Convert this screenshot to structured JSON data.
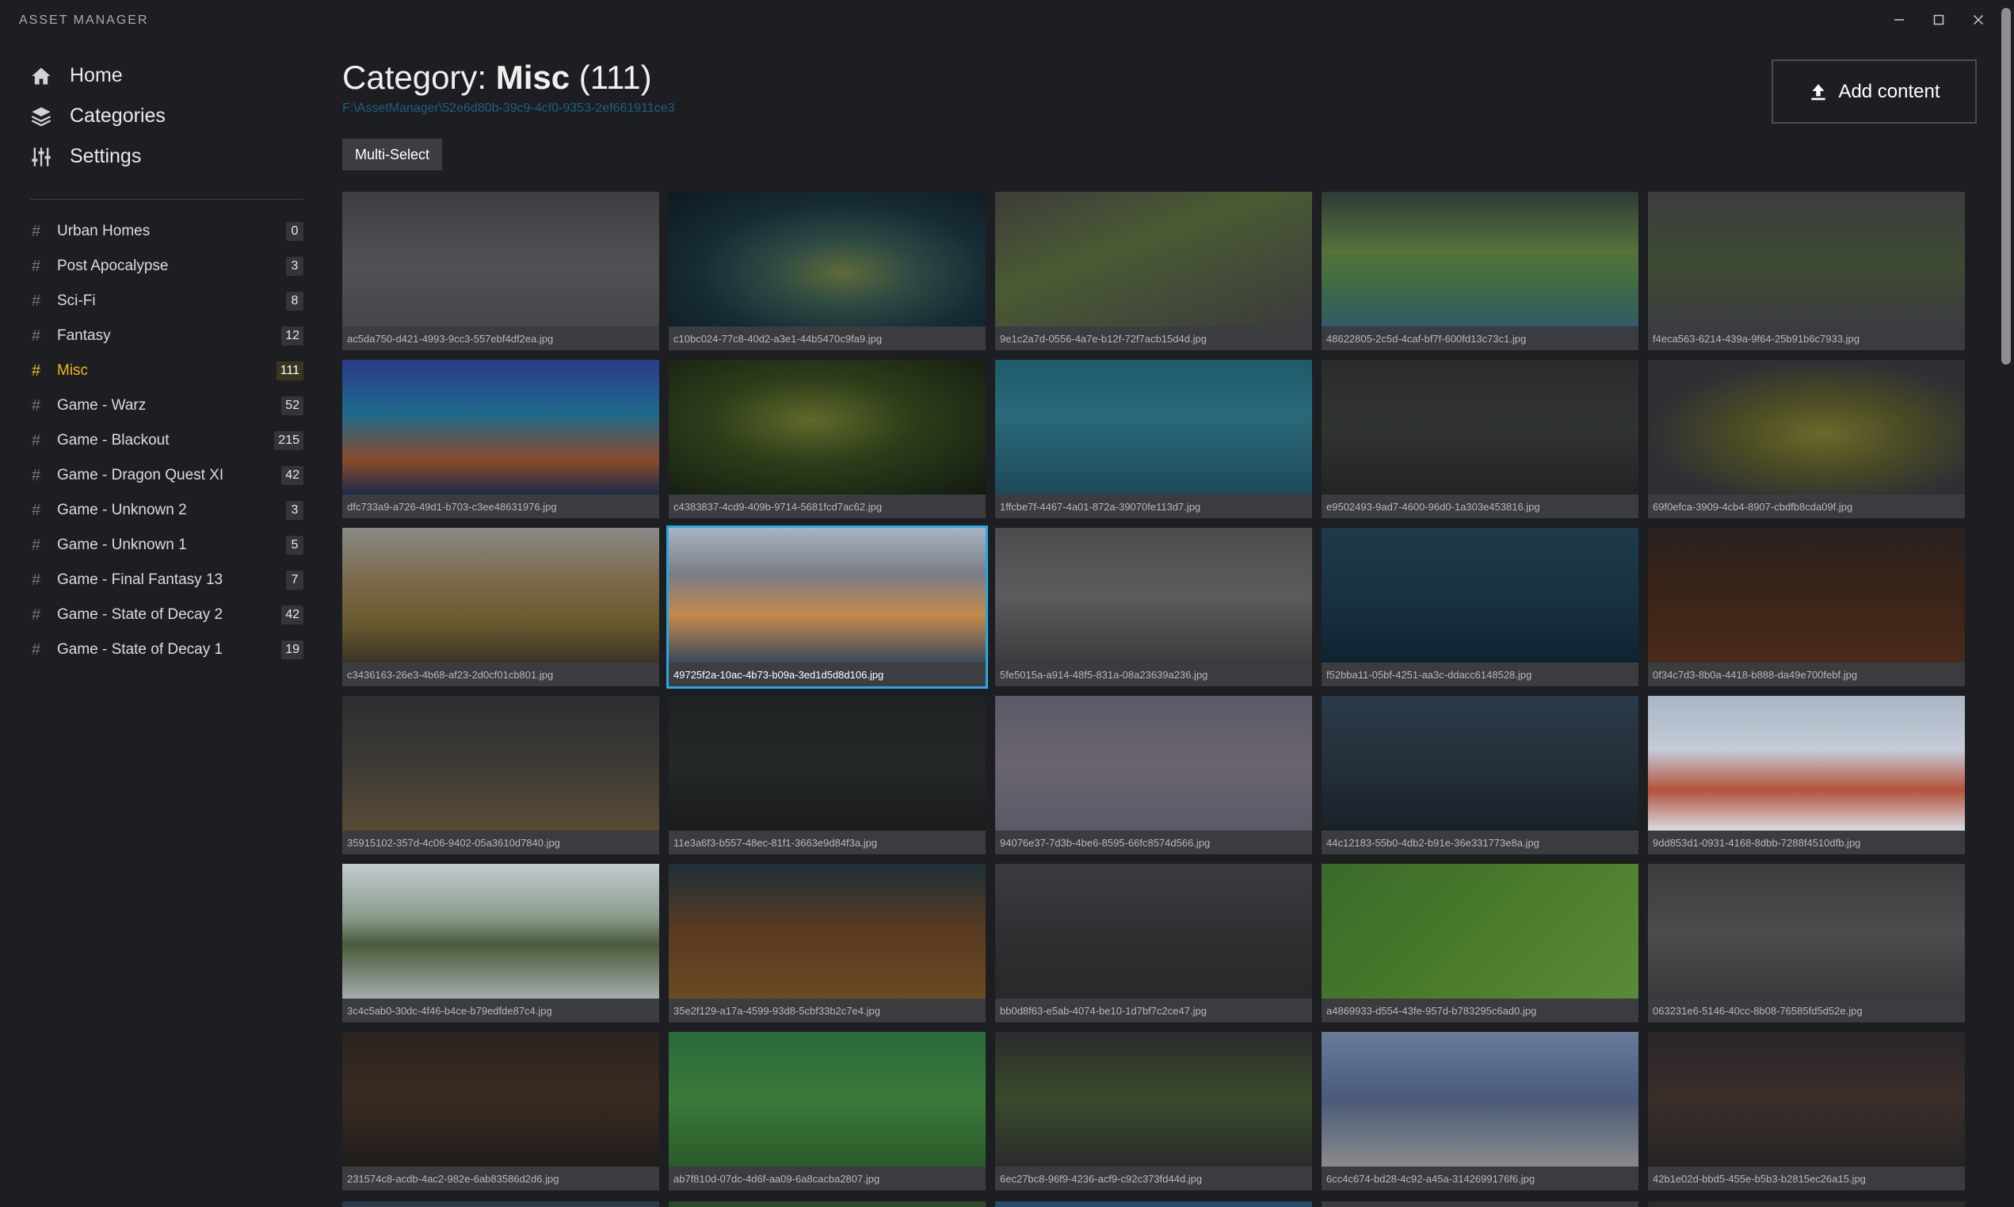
{
  "app": {
    "title": "ASSET MANAGER",
    "window_controls": {
      "minimize": "—",
      "maximize": "☐",
      "close": "✕"
    }
  },
  "sidebar": {
    "nav": [
      {
        "label": "Home",
        "icon": "home-icon"
      },
      {
        "label": "Categories",
        "icon": "layers-icon"
      },
      {
        "label": "Settings",
        "icon": "sliders-icon"
      }
    ],
    "categories": [
      {
        "label": "Urban Homes",
        "count": "0"
      },
      {
        "label": "Post Apocalypse",
        "count": "3"
      },
      {
        "label": "Sci-Fi",
        "count": "8"
      },
      {
        "label": "Fantasy",
        "count": "12"
      },
      {
        "label": "Misc",
        "count": "111",
        "active": true
      },
      {
        "label": "Game - Warz",
        "count": "52"
      },
      {
        "label": "Game - Blackout",
        "count": "215"
      },
      {
        "label": "Game - Dragon Quest XI",
        "count": "42"
      },
      {
        "label": "Game - Unknown 2",
        "count": "3"
      },
      {
        "label": "Game - Unknown 1",
        "count": "5"
      },
      {
        "label": "Game - Final Fantasy 13",
        "count": "7"
      },
      {
        "label": "Game - State of Decay 2",
        "count": "42"
      },
      {
        "label": "Game - State of Decay 1",
        "count": "19"
      }
    ],
    "hash_symbol": "#"
  },
  "main": {
    "title_prefix": "Category: ",
    "title_name": "Misc",
    "title_count": " (111)",
    "path": "F:\\AssetManager\\52e6d80b-39c9-4cf0-9353-2ef661911ce3",
    "multi_select_label": "Multi-Select",
    "add_content_label": "Add content"
  },
  "colors": {
    "background": "#1c1e21",
    "accent_active": "#f2b81c",
    "selection": "#28a8e0",
    "path_link": "#1e5f82"
  },
  "assets": [
    {
      "file": "ac5da750-d421-4993-9cc3-557ebf4df2ea.jpg",
      "bg": "linear-gradient(180deg,#3d3e41 0%,#505154 55%,#44464a 100%)"
    },
    {
      "file": "c10bc024-77c8-40d2-a3e1-44b5470c9fa9.jpg",
      "bg": "radial-gradient(ellipse at 55% 60%,#5f6a3a 0%,#2e4a43 28%,#162b35 60%,#0d1a22 100%)"
    },
    {
      "file": "9e1c2a7d-0556-4a7e-b12f-72f7acb15d4d.jpg",
      "bg": "linear-gradient(160deg,#3b3d3a 0%,#4b5a33 40%,#3a3c3d 100%)"
    },
    {
      "file": "48622805-2c5d-4caf-bf7f-600fd13c73c1.jpg",
      "bg": "linear-gradient(180deg,#2e3a38 0%,#55733a 45%,#3f6a44 70%,#2f5a66 100%)"
    },
    {
      "file": "f4eca563-6214-439a-9f64-25b91b6c7933.jpg",
      "bg": "linear-gradient(180deg,#3b3d40 0%,#3e4a33 55%,#3b3d40 100%)"
    },
    {
      "file": "dfc733a9-a726-49d1-b703-c3ee48631976.jpg",
      "bg": "linear-gradient(180deg,#2a3a8a 0%,#1f6a8a 40%,#8a4a2a 75%,#1a2a4a 100%)"
    },
    {
      "file": "c4383837-4cd9-409b-9714-5681fcd7ac62.jpg",
      "bg": "radial-gradient(ellipse at 45% 45%,#5e6a2a 0%,#2f3d1a 40%,#121a10 100%)"
    },
    {
      "file": "1ffcbe7f-4467-4a01-872a-39070fe113d7.jpg",
      "bg": "linear-gradient(180deg,#1e5a6a 0%,#2a6a7a 40%,#1e4a5a 100%)"
    },
    {
      "file": "e9502493-9ad7-4600-96d0-1a303e453816.jpg",
      "bg": "linear-gradient(180deg,#2a2c2c 0%,#303431 50%,#222424 100%)"
    },
    {
      "file": "69f0efca-3909-4cb4-8907-cbdfb8cda09f.jpg",
      "bg": "radial-gradient(ellipse at 55% 55%,#6a6a2a 0%,#4a4a25 35%,#2e3034 70%)"
    },
    {
      "file": "c3436163-26e3-4b68-af23-2d0cf01cb801.jpg",
      "bg": "linear-gradient(180deg,#8a8a88 0%,#7a6a4a 40%,#6a5a30 70%,#3a3426 100%)"
    },
    {
      "file": "49725f2a-10ac-4b73-b09a-3ed1d5d8d106.jpg",
      "bg": "linear-gradient(180deg,#a8b4c4 0%,#7a7c84 35%,#c28a4a 65%,#3a4a5c 100%)"
    },
    {
      "file": "5fe5015a-a914-48f5-831a-08a23639a236.jpg",
      "bg": "linear-gradient(180deg,#4a4c4e 0%,#5a5c5e 50%,#3a3c3e 100%)"
    },
    {
      "file": "f52bba11-05bf-4251-aa3c-ddacc6148528.jpg",
      "bg": "linear-gradient(180deg,#1e3a4a 0%,#173040 60%,#0f2230 100%)"
    },
    {
      "file": "0f34c7d3-8b0a-4418-b888-da49e700febf.jpg",
      "bg": "linear-gradient(180deg,#2a2220 0%,#3a2418 50%,#4a2a1a 100%)"
    },
    {
      "file": "35915102-357d-4c06-9402-05a3610d7840.jpg",
      "bg": "linear-gradient(180deg,#2c2e30 0%,#3c3a34 50%,#5a4a34 100%)"
    },
    {
      "file": "11e3a6f3-b557-48ec-81f1-3663e9d84f3a.jpg",
      "bg": "linear-gradient(180deg,#1e2222 0%,#242828 50%,#1a1c1c 100%)"
    },
    {
      "file": "94076e37-7d3b-4be6-8595-66fc8574d566.jpg",
      "bg": "linear-gradient(180deg,#5a5a66 0%,#6a6470 50%,#5a5a66 100%)"
    },
    {
      "file": "44c12183-55b0-4db2-b91e-36e331773e8a.jpg",
      "bg": "linear-gradient(180deg,#2a3a4a 0%,#24303a 50%,#1a2028 100%)"
    },
    {
      "file": "9dd853d1-0931-4168-8dbb-7288f4510dfb.jpg",
      "bg": "linear-gradient(180deg,#aab4c4 0%,#c4ccd8 40%,#b4523a 70%,#d8dce4 100%)"
    },
    {
      "file": "3c4c5ab0-30dc-4f46-b4ce-b79edfde87c4.jpg",
      "bg": "linear-gradient(180deg,#c4ccd0 0%,#8a9a8a 40%,#4a5a3a 60%,#a4acac 100%)"
    },
    {
      "file": "35e2f129-a17a-4599-93d8-5cbf33b2c7e4.jpg",
      "bg": "linear-gradient(180deg,#1e3038 0%,#5a3a22 50%,#6a4a22 100%)"
    },
    {
      "file": "bb0d8f63-e5ab-4074-be10-1d7bf7c2ce47.jpg",
      "bg": "linear-gradient(180deg,#3a3c40 0%,#2e3032 50%,#2a2828 100%)"
    },
    {
      "file": "a4869933-d554-43fe-957d-b783295c6ad0.jpg",
      "bg": "linear-gradient(135deg,#3a6a2a 0%,#4a7a2a 50%,#5a8a3a 100%)"
    },
    {
      "file": "063231e6-5146-40cc-8b08-76585fd5d52e.jpg",
      "bg": "linear-gradient(180deg,#3a3c3e 0%,#4a4c4e 50%,#383a3c 100%)"
    },
    {
      "file": "231574c8-acdb-4ac2-982e-6ab83586d2d6.jpg",
      "bg": "linear-gradient(180deg,#2a2420 0%,#3a2a22 50%,#1e1c1a 100%)"
    },
    {
      "file": "ab7f810d-07dc-4d6f-aa09-6a8cacba2807.jpg",
      "bg": "linear-gradient(180deg,#2a6a3a 0%,#3a7a3a 50%,#2a5a2a 100%)"
    },
    {
      "file": "6ec27bc8-96f9-4236-acf9-c92c373fd44d.jpg",
      "bg": "linear-gradient(180deg,#2a2c2e 0%,#3a4a2a 50%,#2a2c2e 100%)"
    },
    {
      "file": "6cc4c674-bd28-4c92-a45a-3142699176f6.jpg",
      "bg": "linear-gradient(180deg,#6a7a9a 0%,#4a5a7a 50%,#8a8a8a 100%)"
    },
    {
      "file": "42b1e02d-bbd5-455e-b5b3-b2815ec26a15.jpg",
      "bg": "linear-gradient(180deg,#2a2628 0%,#3a2e2a 50%,#262424 100%)"
    }
  ],
  "selected_index": 11
}
